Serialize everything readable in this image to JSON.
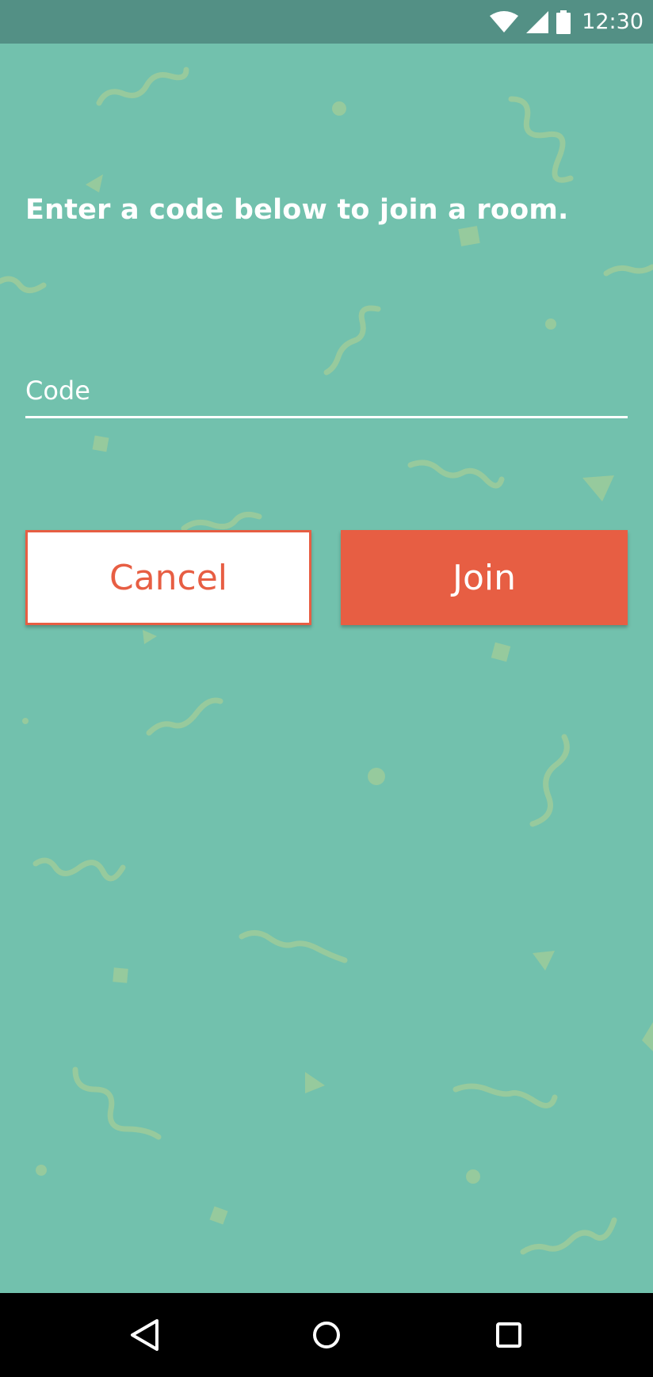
{
  "status_bar": {
    "time": "12:30",
    "icons": [
      "wifi-icon",
      "cell-signal-icon",
      "battery-icon"
    ]
  },
  "screen": {
    "prompt": "Enter a code below to join a room.",
    "code_field": {
      "placeholder": "Code",
      "value": ""
    },
    "buttons": {
      "cancel_label": "Cancel",
      "join_label": "Join"
    }
  },
  "nav_bar": {
    "icons": [
      "back-icon",
      "home-icon",
      "recents-icon"
    ]
  },
  "colors": {
    "background": "#72c1ad",
    "status_bar": "#539085",
    "accent": "#e75e43",
    "confetti": "#9dcb9a",
    "text": "#ffffff"
  }
}
